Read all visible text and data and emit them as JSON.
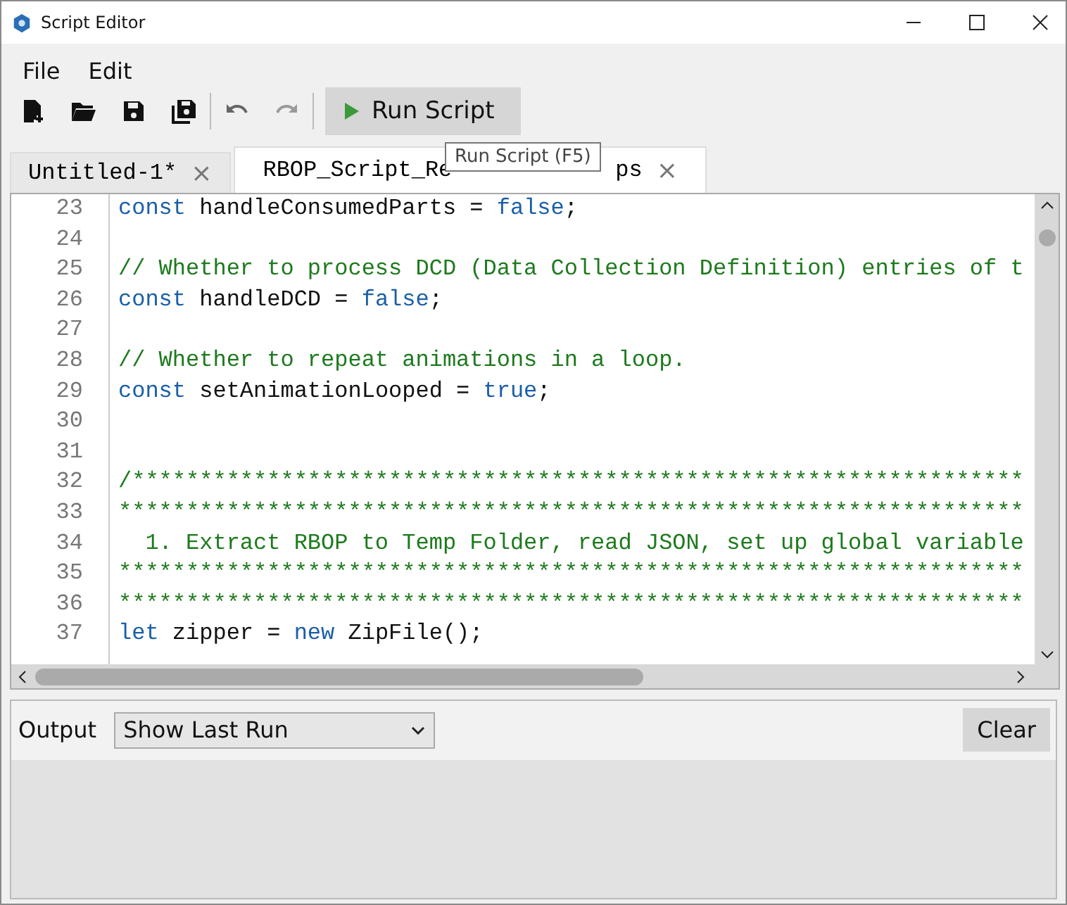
{
  "window": {
    "title": "Script Editor"
  },
  "menu": [
    "File",
    "Edit"
  ],
  "toolbar": {
    "run_button": "Run Script",
    "tooltip": "Run Script (F5)"
  },
  "tabs": [
    {
      "label": "Untitled-1*",
      "selected": false,
      "close": "×"
    },
    {
      "label": "RBOP_Script_Re",
      "label_tail": "ps",
      "selected": true,
      "close": "×"
    }
  ],
  "editor": {
    "lines": [
      {
        "number": "23",
        "tokens": [
          {
            "kind": "keyword",
            "text": "const"
          },
          {
            "kind": "plain",
            "text": " handleConsumedParts = "
          },
          {
            "kind": "keyword",
            "text": "false"
          },
          {
            "kind": "plain",
            "text": ";"
          }
        ]
      },
      {
        "number": "24"
      },
      {
        "number": "25",
        "tokens": [
          {
            "kind": "comment",
            "text": "// Whether to process DCD (Data Collection Definition) entries of t"
          }
        ]
      },
      {
        "number": "26",
        "tokens": [
          {
            "kind": "keyword",
            "text": "const"
          },
          {
            "kind": "plain",
            "text": " handleDCD = "
          },
          {
            "kind": "keyword",
            "text": "false"
          },
          {
            "kind": "plain",
            "text": ";"
          }
        ]
      },
      {
        "number": "27"
      },
      {
        "number": "28",
        "tokens": [
          {
            "kind": "comment",
            "text": "// Whether to repeat animations in a loop."
          }
        ]
      },
      {
        "number": "29",
        "tokens": [
          {
            "kind": "keyword",
            "text": "const"
          },
          {
            "kind": "plain",
            "text": " setAnimationLooped = "
          },
          {
            "kind": "keyword",
            "text": "true"
          },
          {
            "kind": "plain",
            "text": ";"
          }
        ]
      },
      {
        "number": "30"
      },
      {
        "number": "31"
      },
      {
        "number": "32",
        "tokens": [
          {
            "kind": "comment",
            "text": "/******************************************************************"
          }
        ]
      },
      {
        "number": "33",
        "tokens": [
          {
            "kind": "comment",
            "text": "*******************************************************************"
          }
        ]
      },
      {
        "number": "34",
        "tokens": [
          {
            "kind": "comment",
            "text": "  1. Extract RBOP to Temp Folder, read JSON, set up global variable"
          }
        ]
      },
      {
        "number": "35",
        "tokens": [
          {
            "kind": "comment",
            "text": "*******************************************************************"
          }
        ]
      },
      {
        "number": "36",
        "tokens": [
          {
            "kind": "comment",
            "text": "*******************************************************************"
          }
        ]
      },
      {
        "number": "37",
        "tokens": [
          {
            "kind": "keyword",
            "text": "let"
          },
          {
            "kind": "plain",
            "text": " zipper = "
          },
          {
            "kind": "keyword",
            "text": "new"
          },
          {
            "kind": "plain",
            "text": " ZipFile();"
          }
        ]
      }
    ]
  },
  "output": {
    "label": "Output",
    "dropdown": "Show Last Run",
    "clear_button": "Clear"
  }
}
